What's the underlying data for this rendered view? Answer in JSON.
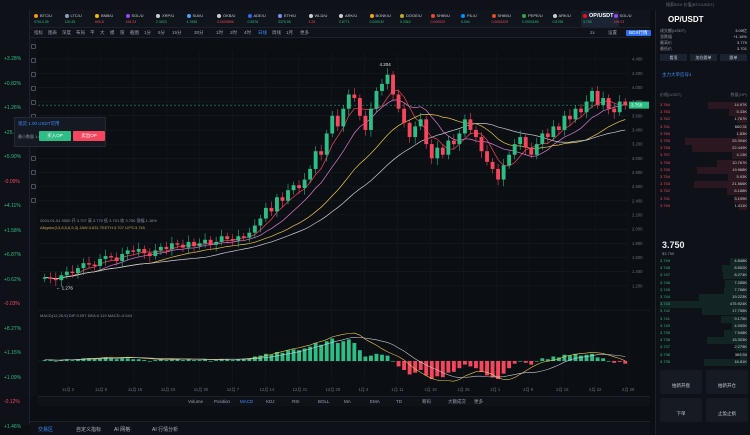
{
  "top_bar": {
    "search_placeholder": "搜索BGX 价值(BTC/USDT)"
  },
  "left_changes": [
    "+3.28%",
    "+0.82%",
    "+1.26%",
    "+25.74%",
    "+5.90%",
    "-0.09%",
    "+4.11%",
    "+1.58%",
    "+6.87%",
    "+0.62%",
    "-0.03%",
    "+8.27%",
    "+1.15%",
    "+1.09%",
    "-0.12%",
    "+1.46%"
  ],
  "ticker": [
    {
      "name": "BTC/U",
      "price": "97614.05",
      "color": "#f7931a",
      "dir": "up"
    },
    {
      "name": "LTC/U",
      "price": "120.45",
      "color": "#8aa0b8",
      "dir": "up"
    },
    {
      "name": "BNB/U",
      "price": "690.8",
      "color": "#f0b90b",
      "dir": "dn"
    },
    {
      "name": "SOL/U",
      "price": "194.23",
      "color": "#9945ff",
      "dir": "dn"
    },
    {
      "name": "XRP/U",
      "price": "2.3023",
      "color": "#c9ced6",
      "dir": "up"
    },
    {
      "name": "SUI/U",
      "price": "4.7836",
      "color": "#4da2ff",
      "dir": "up"
    },
    {
      "name": "OKB/U",
      "price": "0.0000896",
      "color": "#c9ced6",
      "dir": "dn"
    },
    {
      "name": "ADE/U",
      "price": "0.9576",
      "color": "#2d6cf0",
      "dir": "up"
    },
    {
      "name": "ETH/U",
      "price": "3376.95",
      "color": "#7d8cf5",
      "dir": "up"
    },
    {
      "name": "WLD/U",
      "price": "2.25",
      "color": "#c9ced6",
      "dir": "dn"
    },
    {
      "name": "ARK/U",
      "price": "0.8771",
      "color": "#c9ced6",
      "dir": "up"
    },
    {
      "name": "BONK/U",
      "price": "0.000032",
      "color": "#f7a21a",
      "dir": "up"
    },
    {
      "name": "DOGE/U",
      "price": "0.3362",
      "color": "#c2a633",
      "dir": "up"
    },
    {
      "name": "SHIB/U",
      "price": "0.000022",
      "color": "#e34c26",
      "dir": "dn"
    },
    {
      "name": "FIL/U",
      "price": "5.094",
      "color": "#0090ff",
      "dir": "up"
    },
    {
      "name": "SHIB/U",
      "price": "0.0000229",
      "color": "#e34c26",
      "dir": "dn"
    },
    {
      "name": "PEPE/U",
      "price": "0.0000189",
      "color": "#3aa14b",
      "dir": "up"
    },
    {
      "name": "ARK/U",
      "price": "0.8798",
      "color": "#c9ced6",
      "dir": "up"
    },
    {
      "name": "OP/USDT",
      "price": "3.750",
      "color": "#ff0420",
      "dir": "up",
      "active": true
    },
    {
      "name": "SOL/U",
      "price": "194.23",
      "color": "#9945ff",
      "dir": "dn"
    }
  ],
  "toolbar": {
    "items": [
      "指标",
      "图表",
      "深度",
      "布局",
      "平",
      "大",
      "模",
      "隐",
      "截图",
      "1分",
      "5分",
      "15分",
      "30分",
      "1时",
      "2时",
      "4时",
      "日线",
      "周线",
      "1月",
      "更多"
    ],
    "selected": "日线",
    "right": [
      "2x",
      "设置",
      "BGX行情"
    ]
  },
  "legend_line1": "2024-01-01 0000 开 3.707 高 3.770 低 3.701 收 3.750 涨幅 1.16%",
  "legend_line2": "Alligator(13,8,5,8,5,3) JAW:3.631 TEETH:3.707 LIPS:3.745",
  "legend_macd": "MACD(12,26,9) DIF:0.097 DEA:0.119 MACD:-0.044",
  "trade_panel": {
    "title": "现货 1.00 USDT可用",
    "qty": "最小数量 1.0",
    "buy": "买入OP",
    "sell": "卖出OP"
  },
  "indicator_row": [
    "Volume",
    "Position",
    "MACD",
    "KDJ",
    "RSI",
    "BOLL",
    "MA",
    "EMA",
    "TD",
    "筹码",
    "大额成交",
    "更多"
  ],
  "bottom_tabs": [
    "交易区",
    "自定义指标",
    "AI 网格",
    "AI 行情分析"
  ],
  "bottom_tab_selected": "交易区",
  "chart_data": {
    "type": "candlestick",
    "title": "",
    "x_ticks": [
      "11月 2",
      "11月 9",
      "11月 16",
      "11月 23",
      "11月 30",
      "12月 7",
      "12月 14",
      "12月 21",
      "12月 28",
      "1月 4",
      "1月 11",
      "1月 18",
      "1月 25",
      "2月 1",
      "2月 8",
      "2月 15",
      "2月 22",
      "2月 29"
    ],
    "y_ticks": [
      1.2,
      1.4,
      1.6,
      1.8,
      2.0,
      2.2,
      2.4,
      2.6,
      2.8,
      3.0,
      3.2,
      3.4,
      3.6,
      3.8,
      4.0,
      4.2,
      4.4
    ],
    "ylim": [
      1.0,
      4.5
    ],
    "high_label": "4.204",
    "low_label": "1.276",
    "last_price": "3.750",
    "closes": [
      1.32,
      1.3,
      1.28,
      1.35,
      1.4,
      1.38,
      1.45,
      1.52,
      1.5,
      1.48,
      1.58,
      1.62,
      1.6,
      1.55,
      1.65,
      1.7,
      1.68,
      1.72,
      1.66,
      1.62,
      1.7,
      1.75,
      1.72,
      1.8,
      1.78,
      1.74,
      1.82,
      1.76,
      1.8,
      1.85,
      1.78,
      1.82,
      1.9,
      1.86,
      1.84,
      1.9,
      1.88,
      1.95,
      2.05,
      2.15,
      2.3,
      2.25,
      2.45,
      2.4,
      2.55,
      2.62,
      2.58,
      2.7,
      2.85,
      3.1,
      3.05,
      3.35,
      3.6,
      3.45,
      3.7,
      3.9,
      3.85,
      3.6,
      3.4,
      3.7,
      3.95,
      4.05,
      4.18,
      3.9,
      3.7,
      3.5,
      3.3,
      3.45,
      3.55,
      3.2,
      3.0,
      3.15,
      3.05,
      3.25,
      3.2,
      3.35,
      3.55,
      3.4,
      3.3,
      3.1,
      2.95,
      2.85,
      2.7,
      2.9,
      3.05,
      3.2,
      3.3,
      3.15,
      3.05,
      3.2,
      3.35,
      3.3,
      3.45,
      3.4,
      3.6,
      3.55,
      3.7,
      3.65,
      3.8,
      3.95,
      3.75,
      3.85,
      3.7,
      3.65,
      3.8,
      3.75
    ],
    "macd_hist": [
      0.01,
      0.01,
      0.0,
      0.01,
      0.02,
      0.01,
      0.02,
      0.03,
      0.03,
      0.02,
      0.03,
      0.04,
      0.03,
      0.02,
      0.03,
      0.03,
      0.02,
      0.02,
      0.01,
      0.0,
      0.01,
      0.02,
      0.01,
      0.02,
      0.02,
      0.01,
      0.02,
      0.01,
      0.01,
      0.02,
      0.0,
      0.01,
      0.02,
      0.02,
      0.01,
      0.02,
      0.02,
      0.03,
      0.05,
      0.06,
      0.08,
      0.07,
      0.1,
      0.09,
      0.12,
      0.13,
      0.12,
      0.14,
      0.16,
      0.2,
      0.18,
      0.22,
      0.25,
      0.2,
      0.22,
      0.24,
      0.2,
      0.12,
      0.05,
      0.06,
      0.08,
      0.07,
      0.06,
      0.0,
      -0.06,
      -0.1,
      -0.15,
      -0.13,
      -0.1,
      -0.16,
      -0.2,
      -0.17,
      -0.18,
      -0.13,
      -0.12,
      -0.08,
      -0.04,
      -0.06,
      -0.08,
      -0.12,
      -0.16,
      -0.18,
      -0.2,
      -0.14,
      -0.08,
      -0.03,
      0.0,
      -0.02,
      -0.04,
      0.0,
      0.03,
      0.02,
      0.05,
      0.04,
      0.07,
      0.06,
      0.08,
      0.06,
      0.07,
      0.08,
      0.04,
      0.03,
      0.0,
      -0.02,
      -0.01,
      -0.03
    ]
  },
  "right_panel": {
    "pair": "OP/USDT",
    "stats": [
      {
        "k": "成交额(USDT)",
        "v": "3.05亿"
      },
      {
        "k": "涨跌幅",
        "v": "+1.16%"
      },
      {
        "k": "最高价",
        "v": "3.770"
      },
      {
        "k": "最低价",
        "v": "3.701"
      }
    ],
    "buttons": [
      "看涨",
      "加仓跟单",
      "跟单"
    ],
    "section_title": "主力大单信号1",
    "columns": [
      "价格(USDT)",
      "数量(OP)"
    ],
    "asks": [
      {
        "p": "3.764",
        "q": "14.97K"
      },
      {
        "p": "3.763",
        "q": "5.33K"
      },
      {
        "p": "3.762",
        "q": "1.767K"
      },
      {
        "p": "3.761",
        "q": "660.31"
      },
      {
        "p": "3.760",
        "q": "1.83K"
      },
      {
        "p": "3.759",
        "q": "25.394K"
      },
      {
        "p": "3.758",
        "q": "22.449K"
      },
      {
        "p": "3.757",
        "q": "4.13K"
      },
      {
        "p": "3.756",
        "q": "10.767K"
      },
      {
        "p": "3.755",
        "q": "19.968K"
      },
      {
        "p": "3.754",
        "q": "5.93K"
      },
      {
        "p": "3.753",
        "q": "21.566K"
      },
      {
        "p": "3.752",
        "q": "6.188K"
      },
      {
        "p": "3.751",
        "q": "3.199K"
      },
      {
        "p": "3.750",
        "q": "1.011K"
      }
    ],
    "mid_price": "3.750",
    "mid_sub": "$3.750",
    "bids": [
      {
        "p": "3.749",
        "q": "4.848K"
      },
      {
        "p": "3.748",
        "q": "8.652K"
      },
      {
        "p": "3.747",
        "q": "8.274K"
      },
      {
        "p": "3.746",
        "q": "7.285K"
      },
      {
        "p": "3.745",
        "q": "7.768K"
      },
      {
        "p": "3.744",
        "q": "19.223K"
      },
      {
        "p": "3.743",
        "q": "475.924K"
      },
      {
        "p": "3.742",
        "q": "17.755K"
      },
      {
        "p": "3.741",
        "q": "9.175K"
      },
      {
        "p": "3.740",
        "q": "4.092K"
      },
      {
        "p": "3.739",
        "q": "7.548K"
      },
      {
        "p": "3.738",
        "q": "15.303K"
      },
      {
        "p": "3.737",
        "q": "2.279K"
      },
      {
        "p": "3.736",
        "q": "389.94"
      },
      {
        "p": "3.735",
        "q": "16.81K"
      }
    ],
    "actions": [
      "拍新开盘",
      "拍新开仓",
      "下单",
      "止盈止损"
    ]
  }
}
